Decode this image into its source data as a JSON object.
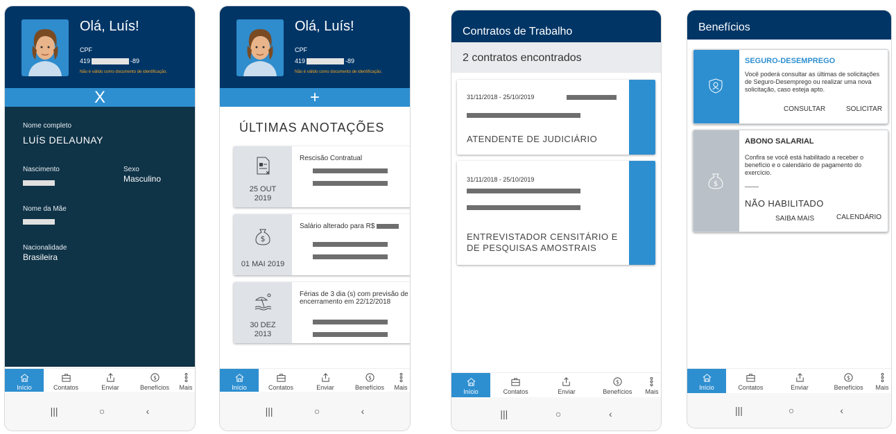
{
  "profile": {
    "greeting": "Olá, Luís!",
    "cpf_label": "CPF",
    "cpf_prefix": "419",
    "cpf_suffix": "-89",
    "cpf_warning": "Não é válido como documento de identificação."
  },
  "toggle": {
    "close_symbol": "X",
    "open_symbol": "+"
  },
  "details": {
    "full_name_label": "Nome completo",
    "full_name_value": "LUÍS DELAUNAY",
    "birth_label": "Nascimento",
    "sex_label": "Sexo",
    "sex_value": "Masculino",
    "mother_label": "Nome da Mãe",
    "nationality_label": "Nacionalidade",
    "nationality_value": "Brasileira"
  },
  "annotations": {
    "title": "ÚLTIMAS ANOTAÇÕES",
    "items": [
      {
        "title": "Rescisão Contratual",
        "date_line1": "25 OUT",
        "date_line2": "2019",
        "icon": "document-icon"
      },
      {
        "title": "Salário alterado para R$",
        "date_line1": "01 MAI 2019",
        "date_line2": "",
        "icon": "money-bag-icon"
      },
      {
        "title": "Férias de 3 dia (s) com previsão de encerramento em 22/12/2018",
        "date_line1": "30 DEZ",
        "date_line2": "2013",
        "icon": "beach-icon"
      }
    ]
  },
  "contracts": {
    "header": "Contratos de Trabalho",
    "count": "2 contratos encontrados",
    "items": [
      {
        "period": "31/11/2018 - 25/10/2019",
        "role": "ATENDENTE DE JUDICIÁRIO"
      },
      {
        "period": "31/11/2018 - 25/10/2019",
        "role": "ENTREVISTADOR CENSITÁRIO E DE PESQUISAS AMOSTRAIS"
      }
    ]
  },
  "benefits": {
    "header": "Benefícios",
    "seguro": {
      "title": "SEGURO-DESEMPREGO",
      "text": "Você poderá consultar as últimas de solicitações de Seguro-Desemprego ou realizar uma nova solicitação, caso esteja apto.",
      "action1": "CONSULTAR",
      "action2": "SOLICITAR"
    },
    "abono": {
      "title": "ABONO SALARIAL",
      "text": "Confira se você está habilitado a receber o benefício e o calendário de pagamento do exercício.",
      "dash": "____",
      "status": "NÃO HABILITADO",
      "action1": "SAIBA MAIS",
      "action2": "CALENDÁRIO"
    }
  },
  "nav": {
    "inicio": "Início",
    "contatos": "Contatos",
    "enviar": "Enviar",
    "beneficios": "Benefícios",
    "mais": "Mais"
  },
  "system": {
    "recent": "|||",
    "home": "○",
    "back": "‹"
  },
  "colors": {
    "navy": "#003566",
    "blue": "#2e8fd0",
    "dark_panel": "#0f3347",
    "warning": "#f5a623"
  }
}
